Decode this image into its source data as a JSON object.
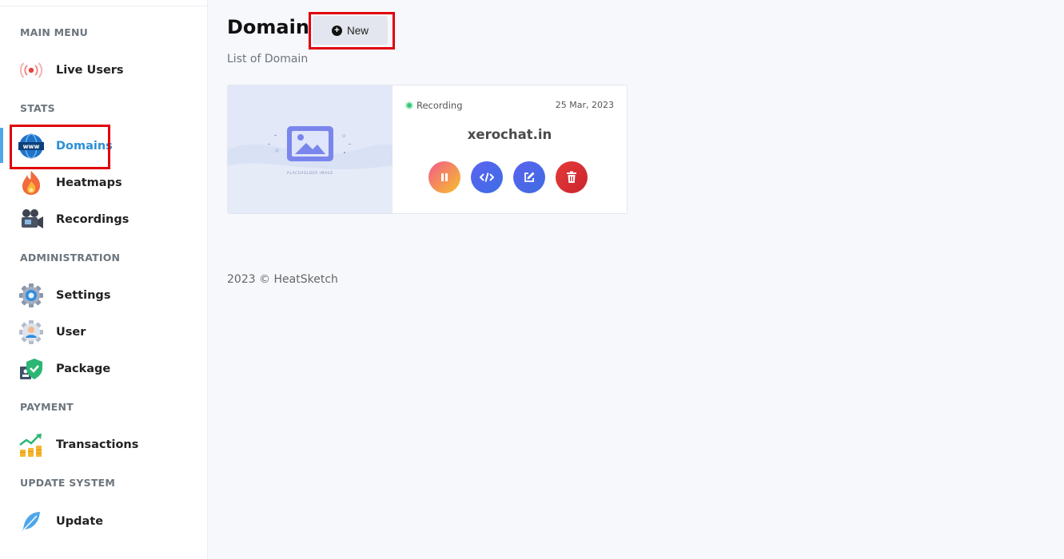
{
  "sidebar": {
    "sections": {
      "main_menu": "MAIN MENU",
      "stats": "STATS",
      "administration": "ADMINISTRATION",
      "payment": "PAYMENT",
      "update_system": "UPDATE SYSTEM"
    },
    "items": {
      "live_users": {
        "label": "Live Users",
        "icon": "live-signal-icon"
      },
      "domains": {
        "label": "Domains",
        "icon": "www-globe-icon",
        "active": true
      },
      "heatmaps": {
        "label": "Heatmaps",
        "icon": "flame-icon"
      },
      "recordings": {
        "label": "Recordings",
        "icon": "video-camera-icon"
      },
      "settings": {
        "label": "Settings",
        "icon": "gear-icon"
      },
      "user": {
        "label": "User",
        "icon": "user-gear-icon"
      },
      "package": {
        "label": "Package",
        "icon": "shield-check-icon"
      },
      "transactions": {
        "label": "Transactions",
        "icon": "growth-coins-icon"
      },
      "update": {
        "label": "Update",
        "icon": "feather-icon"
      }
    }
  },
  "main": {
    "title": "Domain",
    "new_button": "New",
    "subtitle": "List of Domain",
    "domain_card": {
      "thumbnail_text": "PLACEHOLDER IMAGE",
      "status": "Recording",
      "date": "25 Mar, 2023",
      "domain": "xerochat.in",
      "actions": [
        "pause",
        "embed-code",
        "edit",
        "delete"
      ]
    },
    "footer": "2023 © HeatSketch"
  },
  "colors": {
    "accent": "#2d8fd6",
    "highlight": "#e0000b",
    "status_green": "#36c879"
  }
}
